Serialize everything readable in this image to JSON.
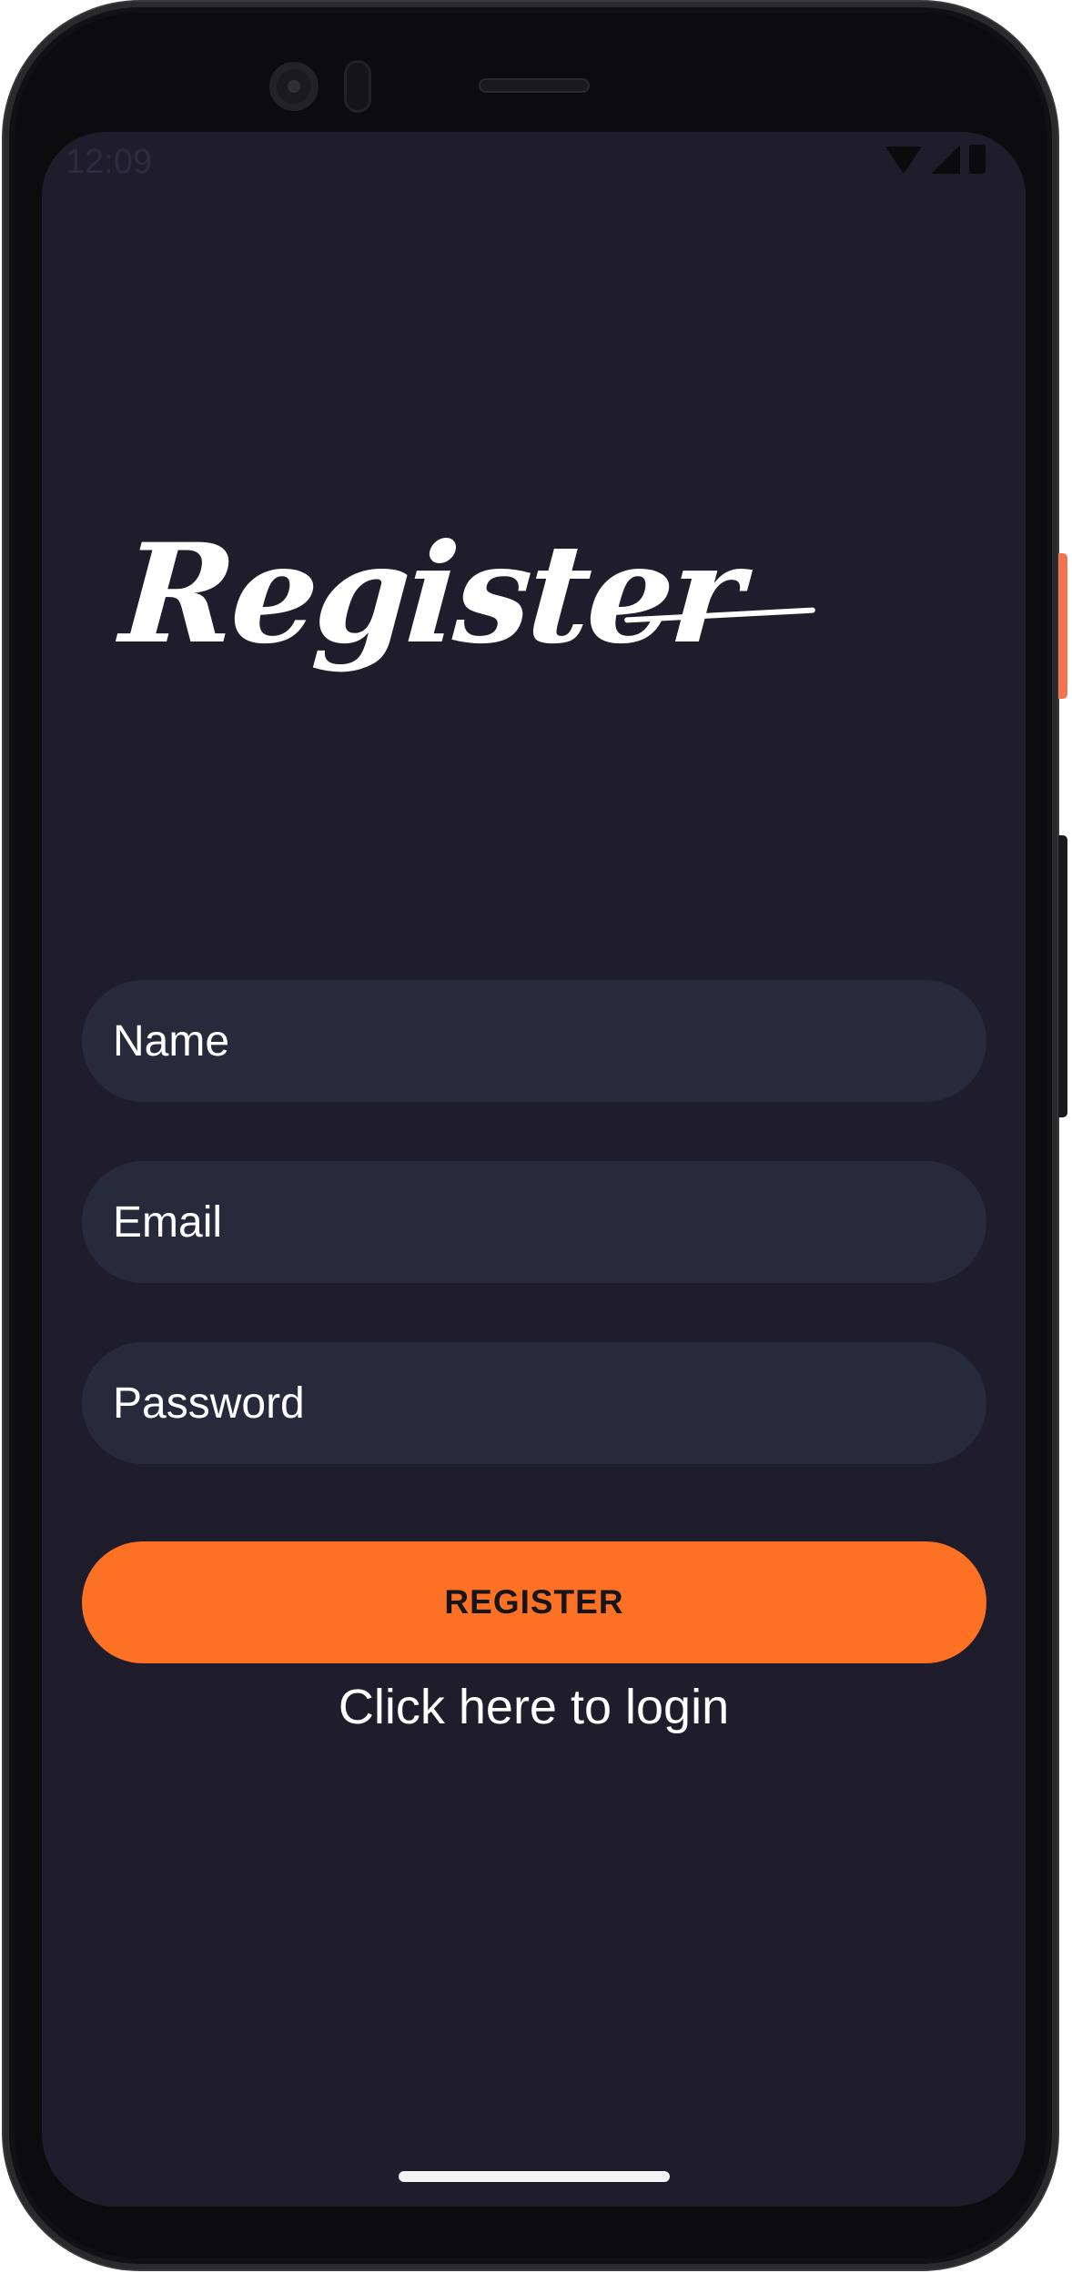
{
  "status_bar": {
    "time": "12:09",
    "icons": [
      "wifi-icon",
      "signal-icon",
      "battery-icon"
    ]
  },
  "page": {
    "title": "Register"
  },
  "form": {
    "name_placeholder": "Name",
    "email_placeholder": "Email",
    "password_placeholder": "Password",
    "submit_label": "REGISTER",
    "login_link": "Click here to login"
  },
  "colors": {
    "background": "#1f1d2b",
    "field": "#262a3b",
    "accent": "#fd7125",
    "text": "#ffffff"
  }
}
